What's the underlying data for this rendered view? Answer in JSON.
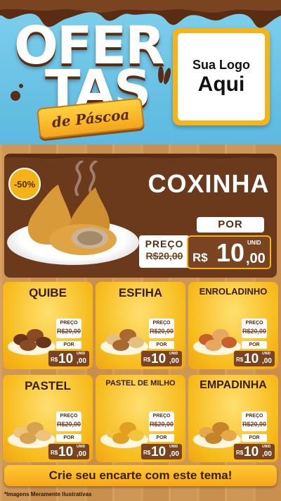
{
  "header": {
    "title_line1": "OFER",
    "title_line2": "TAS",
    "subtitle": "de Páscoa",
    "logo_line1": "Sua Logo",
    "logo_line2": "Aqui"
  },
  "featured": {
    "discount": "-50%",
    "name": "COXINHA",
    "preco_label": "PREÇO",
    "old_price": "R$20,00",
    "por_label": "POR",
    "currency": "R$",
    "price_int": "10",
    "price_dec": ",00",
    "unit": "UNID"
  },
  "products": [
    {
      "name": "QUIBE",
      "preco_label": "PREÇO",
      "old_price": "R$20,00",
      "por_label": "POR",
      "currency": "R$",
      "price_int": "10",
      "price_dec": ",00",
      "unit": "UNID"
    },
    {
      "name": "ESFIHA",
      "preco_label": "PREÇO",
      "old_price": "R$20,00",
      "por_label": "POR",
      "currency": "R$",
      "price_int": "10",
      "price_dec": ",00",
      "unit": "UNID"
    },
    {
      "name": "ENROLADINHO",
      "preco_label": "PREÇO",
      "old_price": "R$20,00",
      "por_label": "POR",
      "currency": "R$",
      "price_int": "10",
      "price_dec": ",00",
      "unit": "UNID"
    },
    {
      "name": "PASTEL",
      "preco_label": "PREÇO",
      "old_price": "R$20,00",
      "por_label": "POR",
      "currency": "R$",
      "price_int": "10",
      "price_dec": ",00",
      "unit": "UNID"
    },
    {
      "name": "PASTEL DE MILHO",
      "preco_label": "PREÇO",
      "old_price": "R$20,00",
      "por_label": "POR",
      "currency": "R$",
      "price_int": "10",
      "price_dec": ",00",
      "unit": "UNID"
    },
    {
      "name": "EMPADINHA",
      "preco_label": "PREÇO",
      "old_price": "R$20,00",
      "por_label": "POR",
      "currency": "R$",
      "price_int": "10",
      "price_dec": ",00",
      "unit": "UNID"
    }
  ],
  "footer": {
    "cta": "Crie seu encarte com este tema!",
    "disclaimer": "*Imagens Meramente Ilustrativas"
  },
  "colors": {
    "sky": "#6cc6e8",
    "chocolate": "#5a2d12",
    "gold": "#f5b318",
    "price_bg": "#7a4420"
  }
}
